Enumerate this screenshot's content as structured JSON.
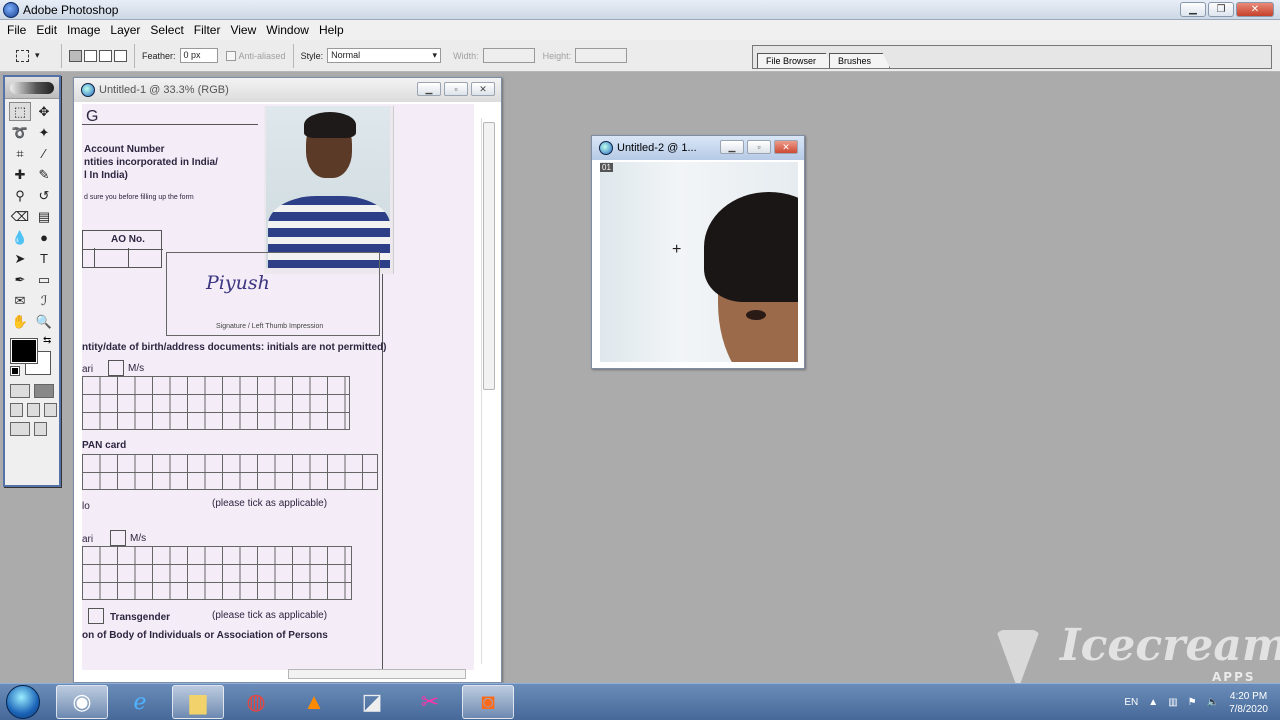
{
  "app": {
    "title": "Adobe Photoshop"
  },
  "window_controls": {
    "minimize": "▁",
    "restore": "❐",
    "close": "✕"
  },
  "menu": [
    "File",
    "Edit",
    "Image",
    "Layer",
    "Select",
    "Filter",
    "View",
    "Window",
    "Help"
  ],
  "options_bar": {
    "feather_label": "Feather:",
    "feather_value": "0 px",
    "antialias_label": "Anti-aliased",
    "style_label": "Style:",
    "style_value": "Normal",
    "width_label": "Width:",
    "height_label": "Height:"
  },
  "palette_well": {
    "tabs": [
      "File Browser",
      "Brushes"
    ]
  },
  "toolbox": {
    "tools": [
      {
        "name": "marquee-tool",
        "icon": "⬚"
      },
      {
        "name": "move-tool",
        "icon": "✥"
      },
      {
        "name": "lasso-tool",
        "icon": "➰"
      },
      {
        "name": "magic-wand-tool",
        "icon": "✦"
      },
      {
        "name": "crop-tool",
        "icon": "⌗"
      },
      {
        "name": "slice-tool",
        "icon": "⁄"
      },
      {
        "name": "healing-brush-tool",
        "icon": "✚"
      },
      {
        "name": "brush-tool",
        "icon": "✎"
      },
      {
        "name": "clone-stamp-tool",
        "icon": "⚲"
      },
      {
        "name": "history-brush-tool",
        "icon": "↺"
      },
      {
        "name": "eraser-tool",
        "icon": "⌫"
      },
      {
        "name": "gradient-tool",
        "icon": "▤"
      },
      {
        "name": "blur-tool",
        "icon": "💧"
      },
      {
        "name": "dodge-tool",
        "icon": "●"
      },
      {
        "name": "path-selection-tool",
        "icon": "➤"
      },
      {
        "name": "type-tool",
        "icon": "T"
      },
      {
        "name": "pen-tool",
        "icon": "✒"
      },
      {
        "name": "shape-tool",
        "icon": "▭"
      },
      {
        "name": "notes-tool",
        "icon": "✉"
      },
      {
        "name": "eyedropper-tool",
        "icon": "ℐ"
      },
      {
        "name": "hand-tool",
        "icon": "✋"
      },
      {
        "name": "zoom-tool",
        "icon": "🔍"
      }
    ],
    "foreground_color": "#000000",
    "background_color": "#ffffff"
  },
  "documents": [
    {
      "title": "Untitled-1 @ 33.3% (RGB)"
    },
    {
      "title": "Untitled-2 @ 1...",
      "layer_tag": "01"
    }
  ],
  "form": {
    "header_code": "G",
    "account_number": "Account Number",
    "entities_line": "ntities incorporated in India/",
    "in_india": "l In India)",
    "small_note": "d sure you before filling up the form",
    "ao_no": "AO No.",
    "signature": "Piyush",
    "signature_caption": "Signature / Left Thumb Impression",
    "docs_note": "ntity/date of birth/address documents: initials are not permitted)",
    "ari1": "ari",
    "ms1": "M/s",
    "pan_card": "PAN card",
    "lo": "lo",
    "tick1": "(please tick as applicable)",
    "ari2": "ari",
    "ms2": "M/s",
    "transgender": "Transgender",
    "tick2": "(please tick as applicable)",
    "body_of_individuals": "on of Body of Individuals or Association of Persons"
  },
  "taskbar": {
    "apps": [
      "Photoshop",
      "Internet Explorer",
      "File Explorer",
      "Chrome",
      "VLC",
      "Scanner",
      "Snipping Tool",
      "Icecream Recorder"
    ],
    "language": "EN",
    "time": "4:20 PM",
    "date": "7/8/2020"
  },
  "watermark": {
    "brand": "Icecream",
    "sub": "APPS"
  }
}
